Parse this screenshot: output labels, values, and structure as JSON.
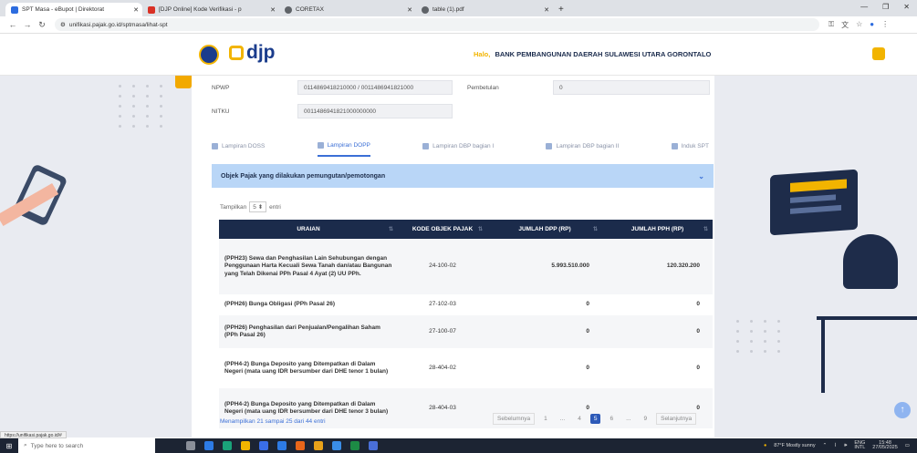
{
  "browser": {
    "tabs": [
      {
        "title": "SPT Masa - eBupot | Direktorat",
        "active": true,
        "color": "#2d6cdf"
      },
      {
        "title": "[DJP Online] Kode Verifikasi - p",
        "active": false,
        "color": "#d93025"
      },
      {
        "title": "CORETAX",
        "active": false,
        "color": "#5f6368"
      },
      {
        "title": "table (1).pdf",
        "active": false,
        "color": "#5f6368"
      }
    ],
    "new_tab": "+",
    "url": "unifikasi.pajak.go.id/sptmasa/lihat-spt",
    "status_url": "https://unifikasi.pajak.go.id/#"
  },
  "header": {
    "logo_text": "djp",
    "greeting_hi": "Halo,",
    "greeting_name": "BANK PEMBANGUNAN DAERAH SULAWESI UTARA GORONTALO"
  },
  "form": {
    "npwp_label": "NPWP",
    "npwp_value": "0114869418210000 / 0011486941821000",
    "pembetulan_label": "Pembetulan",
    "pembetulan_value": "0",
    "nitku_label": "NITKU",
    "nitku_value": "0011486941821000000000"
  },
  "tabs": [
    {
      "label": "Lampiran DOSS",
      "active": false
    },
    {
      "label": "Lampiran DOPP",
      "active": true
    },
    {
      "label": "Lampiran DBP bagian I",
      "active": false
    },
    {
      "label": "Lampiran DBP bagian II",
      "active": false
    },
    {
      "label": "Induk SPT",
      "active": false
    }
  ],
  "section_title": "Objek Pajak yang dilakukan pemungutan/pemotongan",
  "show": {
    "prefix": "Tampilkan",
    "value": "5",
    "suffix": "entri"
  },
  "table": {
    "headers": [
      "URAIAN",
      "KODE OBJEK PAJAK",
      "JUMLAH DPP (RP)",
      "JUMLAH PPH (RP)"
    ],
    "rows": [
      {
        "uraian": "(PPH23) Sewa dan Penghasilan Lain Sehubungan dengan Penggunaan Harta Kecuali Sewa Tanah dan/atau Bangunan yang Telah Dikenai PPh Pasal 4 Ayat (2) UU PPh.",
        "kode": "24-100-02",
        "dpp": "5.993.510.000",
        "pph": "120.320.200"
      },
      {
        "uraian": "(PPH26) Bunga Obligasi (PPh Pasal 26)",
        "kode": "27-102-03",
        "dpp": "0",
        "pph": "0"
      },
      {
        "uraian": "(PPH26) Penghasilan dari Penjualan/Pengalihan Saham (PPh Pasal 26)",
        "kode": "27-100-07",
        "dpp": "0",
        "pph": "0"
      },
      {
        "uraian": "(PPH4-2) Bunga Deposito yang Ditempatkan di Dalam Negeri (mata uang IDR bersumber dari DHE tenor 1 bulan)",
        "kode": "28-404-02",
        "dpp": "0",
        "pph": "0"
      },
      {
        "uraian": "(PPH4-2) Bunga Deposito yang Ditempatkan di Dalam Negeri (mata uang IDR bersumber dari DHE tenor 3 bulan)",
        "kode": "28-404-03",
        "dpp": "0",
        "pph": "0"
      }
    ]
  },
  "footer_info": "Menampilkan 21 sampai 25 dari 44 entri",
  "pagination": {
    "prev": "Sebelumnya",
    "pages": [
      "1",
      "...",
      "4",
      "5",
      "6",
      "...",
      "9"
    ],
    "active_index": 3,
    "next": "Selanjutnya"
  },
  "taskbar": {
    "search_placeholder": "Type here to search",
    "weather": "87°F Mostly sunny",
    "lang": "ENG",
    "lang2": "INTL",
    "time": "15:48",
    "date": "27/05/2025"
  }
}
